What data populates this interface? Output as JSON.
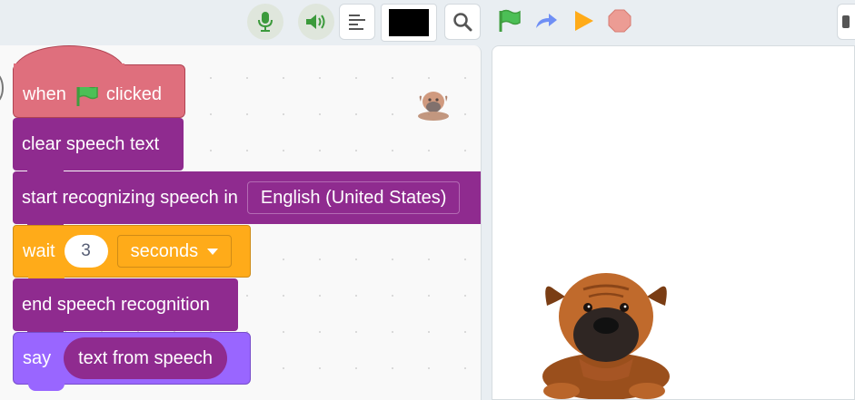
{
  "toolbar": {
    "icons": [
      "microphone-icon",
      "speaker-icon",
      "align-left-icon",
      "pen-color-swatch",
      "search-icon",
      "green-flag-icon",
      "redo-arrow-icon",
      "play-icon",
      "stop-icon"
    ],
    "pen_color": "#000000"
  },
  "script": {
    "hat_block": {
      "prefix": "when",
      "flag_icon": "green-flag-icon",
      "suffix": "clicked"
    },
    "clear_block": {
      "label": "clear speech text"
    },
    "recognize_block": {
      "label": "start recognizing speech in",
      "language": "English (United States)"
    },
    "wait_block": {
      "label": "wait",
      "value": "3",
      "unit": "seconds"
    },
    "end_block": {
      "label": "end speech recognition"
    },
    "say_block": {
      "label": "say",
      "reporter": "text from speech"
    }
  },
  "stage": {
    "sprite": "bulldog-sprite"
  },
  "colors": {
    "events": "#df6f7d",
    "extension": "#8f2b8f",
    "control": "#ffab19",
    "looks": "#9966ff"
  }
}
